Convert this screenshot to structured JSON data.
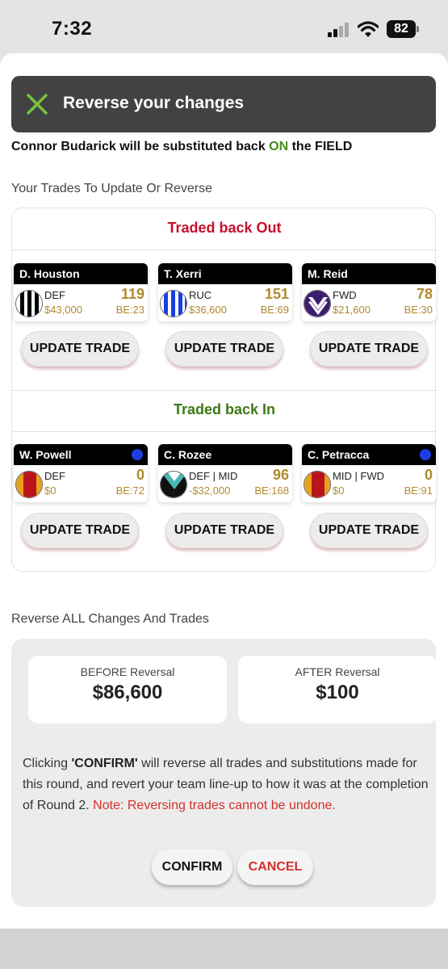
{
  "status_bar": {
    "time": "7:32",
    "battery": "82"
  },
  "toast": {
    "title": "Reverse your changes",
    "icon": "close-icon"
  },
  "hidden_message": {
    "pre": "Connor Budarick will be substituted back ",
    "on": "ON",
    "post": " the FIELD"
  },
  "trades_section": {
    "label": "Your Trades To Update Or Reverse",
    "traded_out_title": "Traded back Out",
    "traded_in_title": "Traded back In",
    "traded_out": [
      {
        "name": "D. Houston",
        "position": "DEF",
        "price": "$43,000",
        "score": "119",
        "be": "BE:23",
        "team": "collingwood"
      },
      {
        "name": "T. Xerri",
        "position": "RUC",
        "price": "$36,600",
        "score": "151",
        "be": "BE:69",
        "team": "north"
      },
      {
        "name": "M. Reid",
        "position": "FWD",
        "price": "$21,600",
        "score": "78",
        "be": "BE:30",
        "team": "fremantle"
      }
    ],
    "traded_in": [
      {
        "name": "W. Powell",
        "position": "DEF",
        "price": "$0",
        "score": "0",
        "be": "BE:72",
        "team": "goldcoast",
        "dot": true
      },
      {
        "name": "C. Rozee",
        "position": "DEF | MID",
        "price": "-$32,000",
        "score": "96",
        "be": "BE:168",
        "team": "portadelaide",
        "dot": false
      },
      {
        "name": "C. Petracca",
        "position": "MID | FWD",
        "price": "$0",
        "score": "0",
        "be": "BE:91",
        "team": "goldcoast",
        "dot": true
      }
    ],
    "update_label": "UPDATE TRADE"
  },
  "reverse_section": {
    "label": "Reverse ALL Changes And Trades",
    "before_label": "BEFORE Reversal",
    "before_value": "$86,600",
    "after_label": "AFTER Reversal",
    "after_value": "$100",
    "notice_pre": "Clicking ",
    "notice_bold": "'CONFIRM'",
    "notice_mid": " will reverse all trades and substitutions made for this round, and revert your team line-up to how it was at the completion of Round 2. ",
    "notice_warn": "Note: Reversing trades cannot be undone.",
    "confirm_label": "CONFIRM",
    "cancel_label": "CANCEL"
  },
  "colors": {
    "traded_out": "#c8102e",
    "traded_in": "#3d7a16",
    "gold": "#b08a2c",
    "warn": "#d4302c"
  }
}
